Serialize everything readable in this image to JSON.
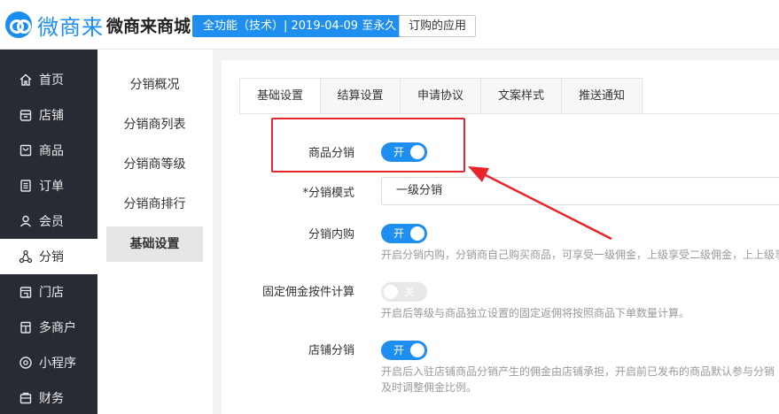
{
  "header": {
    "logo_text": "微商来",
    "store_name": "微商来商城",
    "plan_badge": "全功能（技术）| 2019-04-09 至永久",
    "ordered_apps": "订购的应用"
  },
  "sidebar": {
    "items": [
      {
        "label": "首页",
        "icon": "home-icon"
      },
      {
        "label": "店铺",
        "icon": "store-icon"
      },
      {
        "label": "商品",
        "icon": "product-icon"
      },
      {
        "label": "订单",
        "icon": "order-icon"
      },
      {
        "label": "会员",
        "icon": "member-icon"
      },
      {
        "label": "分销",
        "icon": "distribution-icon",
        "active": true
      },
      {
        "label": "门店",
        "icon": "shop-icon"
      },
      {
        "label": "多商户",
        "icon": "multi-merchant-icon"
      },
      {
        "label": "小程序",
        "icon": "mini-program-icon"
      },
      {
        "label": "财务",
        "icon": "finance-icon"
      }
    ]
  },
  "subnav": {
    "items": [
      {
        "label": "分销概况"
      },
      {
        "label": "分销商列表"
      },
      {
        "label": "分销商等级"
      },
      {
        "label": "分销商排行"
      },
      {
        "label": "基础设置",
        "active": true
      }
    ]
  },
  "tabs": [
    {
      "label": "基础设置",
      "active": true
    },
    {
      "label": "结算设置"
    },
    {
      "label": "申请协议"
    },
    {
      "label": "文案样式"
    },
    {
      "label": "推送通知"
    }
  ],
  "settings": {
    "product_distribution": {
      "label": "商品分销",
      "state": "开",
      "on": true
    },
    "distribution_mode": {
      "label": "*分销模式",
      "value": "一级分销"
    },
    "internal_purchase": {
      "label": "分销内购",
      "state": "开",
      "on": true,
      "hint": "开启分销内购，分销商自己购买商品，可享受一级佣金，上级享受二级佣金，上上级享"
    },
    "fixed_commission": {
      "label": "固定佣金按件计算",
      "state": "关",
      "on": false,
      "hint": "开启后等级与商品独立设置的固定返佣将按照商品下单数量计算。"
    },
    "store_distribution": {
      "label": "店铺分销",
      "state": "开",
      "on": true,
      "hint_line1": "开启后入驻店铺商品分销产生的佣金由店铺承担，开启前已发布的商品默认参与分销",
      "hint_line2": "及时调整佣金比例。"
    }
  },
  "colors": {
    "accent": "#1e8ef0",
    "sidebar_bg": "#282b33",
    "highlight": "#e8242c"
  }
}
